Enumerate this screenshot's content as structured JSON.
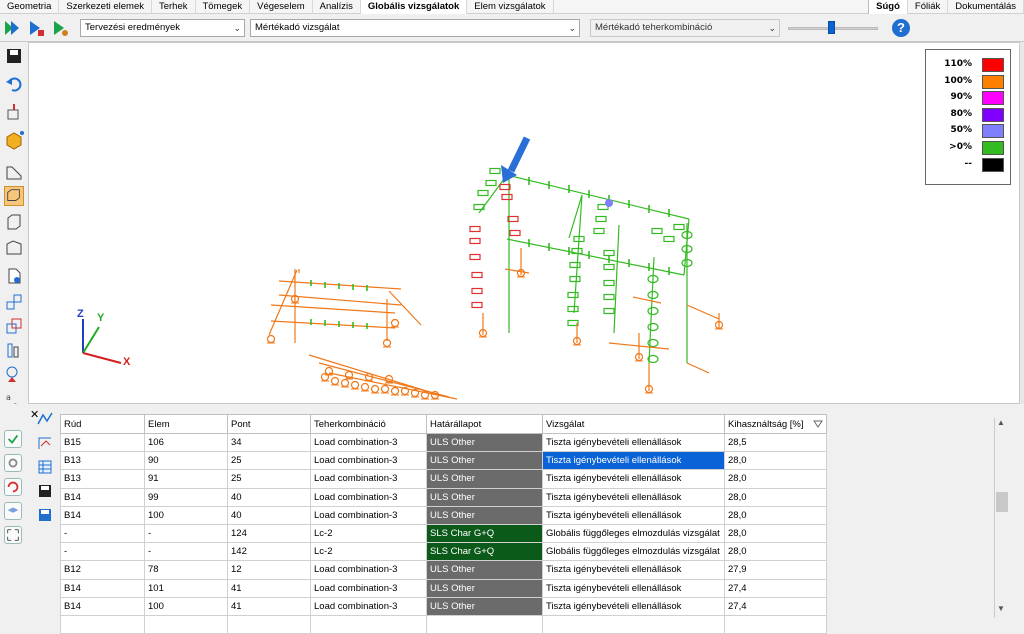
{
  "menubar": {
    "tabs": [
      {
        "label": "Geometria",
        "active": false
      },
      {
        "label": "Szerkezeti elemek",
        "active": false
      },
      {
        "label": "Terhek",
        "active": false
      },
      {
        "label": "Tömegek",
        "active": false
      },
      {
        "label": "Végeselem",
        "active": false
      },
      {
        "label": "Analízis",
        "active": false
      },
      {
        "label": "Globális vizsgálatok",
        "active": true
      },
      {
        "label": "Elem vizsgálatok",
        "active": false
      }
    ],
    "right_tabs": [
      {
        "label": "Súgó",
        "active": true
      },
      {
        "label": "Fóliák",
        "active": false
      },
      {
        "label": "Dokumentálás",
        "active": false
      }
    ]
  },
  "toolbar": {
    "result_type": "Tervezési eredmények",
    "check_type": "Mértékadó vizsgálat",
    "combination": "Mértékadó teherkombináció",
    "icons": [
      "run-icon",
      "run-selected-icon",
      "run-settings-icon",
      "help-icon"
    ]
  },
  "legend": [
    {
      "label": "110%",
      "color": "#ff0000"
    },
    {
      "label": "100%",
      "color": "#ff8000"
    },
    {
      "label": "90%",
      "color": "#ff00ff"
    },
    {
      "label": "80%",
      "color": "#8000ff"
    },
    {
      "label": "50%",
      "color": "#8080ff"
    },
    {
      "label": ">0%",
      "color": "#33bb22"
    },
    {
      "label": "--",
      "color": "#000000"
    }
  ],
  "axes": {
    "x": "X",
    "y": "Y",
    "z": "Z"
  },
  "table": {
    "columns": [
      "Rúd",
      "Elem",
      "Pont",
      "Teherkombináció",
      "Határállapot",
      "Vizsgálat",
      "Kihasználtság [%]"
    ],
    "rows": [
      [
        "B15",
        "106",
        "34",
        "Load combination-3",
        "ULS Other",
        "Tiszta igénybevételi ellenállások",
        "28,5"
      ],
      [
        "B13",
        "90",
        "25",
        "Load combination-3",
        "ULS Other",
        "Tiszta igénybevételi ellenállások",
        "28,0"
      ],
      [
        "B13",
        "91",
        "25",
        "Load combination-3",
        "ULS Other",
        "Tiszta igénybevételi ellenállások",
        "28,0"
      ],
      [
        "B14",
        "99",
        "40",
        "Load combination-3",
        "ULS Other",
        "Tiszta igénybevételi ellenállások",
        "28,0"
      ],
      [
        "B14",
        "100",
        "40",
        "Load combination-3",
        "ULS Other",
        "Tiszta igénybevételi ellenállások",
        "28,0"
      ],
      [
        "-",
        "-",
        "124",
        "Lc-2",
        "SLS Char G+Q",
        "Globális függőleges elmozdulás vizsgálat",
        "28,0"
      ],
      [
        "-",
        "-",
        "142",
        "Lc-2",
        "SLS Char G+Q",
        "Globális függőleges elmozdulás vizsgálat",
        "28,0"
      ],
      [
        "B12",
        "78",
        "12",
        "Load combination-3",
        "ULS Other",
        "Tiszta igénybevételi ellenállások",
        "27,9"
      ],
      [
        "B14",
        "101",
        "41",
        "Load combination-3",
        "ULS Other",
        "Tiszta igénybevételi ellenállások",
        "27,4"
      ],
      [
        "B14",
        "100",
        "41",
        "Load combination-3",
        "ULS Other",
        "Tiszta igénybevételi ellenállások",
        "27,4"
      ],
      [
        "",
        "",
        "",
        "",
        "",
        "",
        ""
      ]
    ],
    "selected": {
      "row": 1,
      "col": 5
    }
  }
}
